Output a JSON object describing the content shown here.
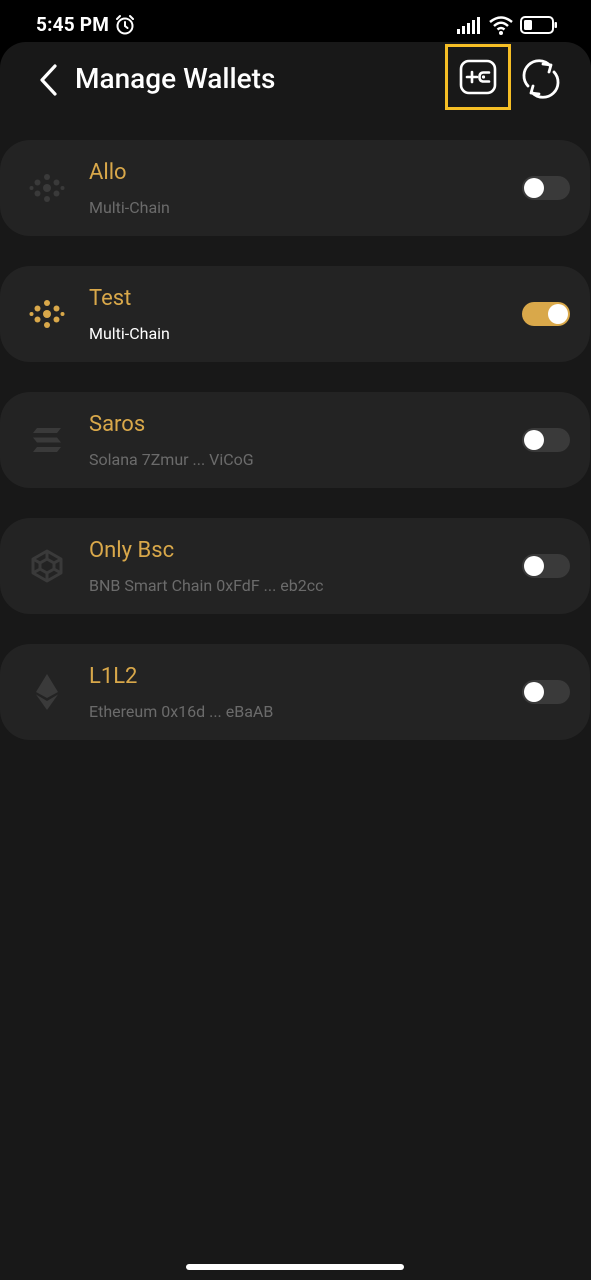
{
  "status_bar": {
    "time": "5:45 PM",
    "icons": [
      "alarm-icon",
      "signal-icon",
      "wifi-icon",
      "battery-icon"
    ]
  },
  "header": {
    "title": "Manage Wallets",
    "back_icon": "chevron-left-icon",
    "add_icon": "add-wallet-icon",
    "sync_icon": "sync-icon",
    "highlight_color": "#f5be25"
  },
  "wallets": [
    {
      "name": "Allo",
      "subtitle": "Multi-Chain",
      "icon": "multichain-icon",
      "enabled": false
    },
    {
      "name": "Test",
      "subtitle": "Multi-Chain",
      "icon": "multichain-icon",
      "enabled": true
    },
    {
      "name": "Saros",
      "subtitle": "Solana 7Zmur ... ViCoG",
      "icon": "solana-icon",
      "enabled": false
    },
    {
      "name": "Only Bsc",
      "subtitle": "BNB Smart Chain 0xFdF ... eb2cc",
      "icon": "bnb-icon",
      "enabled": false
    },
    {
      "name": "L1L2",
      "subtitle": "Ethereum 0x16d ... eBaAB",
      "icon": "ethereum-icon",
      "enabled": false
    }
  ],
  "colors": {
    "accent": "#d9a84a",
    "background": "#181818",
    "card": "#232323"
  }
}
